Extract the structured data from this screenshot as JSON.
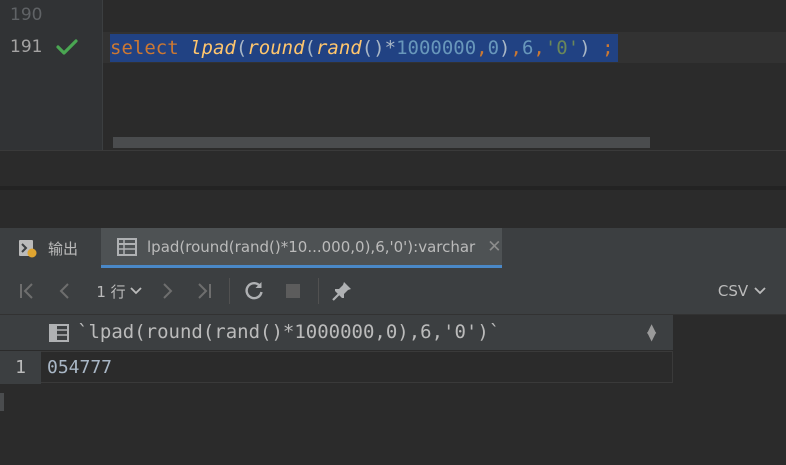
{
  "editor": {
    "lines": [
      {
        "number": "190"
      },
      {
        "number": "191"
      }
    ],
    "code_tokens": [
      {
        "text": "select",
        "cls": "kw"
      },
      {
        "text": " ",
        "cls": "pn"
      },
      {
        "text": "lpad",
        "cls": "fn"
      },
      {
        "text": "(",
        "cls": "pn"
      },
      {
        "text": "round",
        "cls": "fn"
      },
      {
        "text": "(",
        "cls": "pn"
      },
      {
        "text": "rand",
        "cls": "fn"
      },
      {
        "text": "()*",
        "cls": "pn"
      },
      {
        "text": "1000000",
        "cls": "num"
      },
      {
        "text": ",",
        "cls": "kw"
      },
      {
        "text": "0",
        "cls": "num"
      },
      {
        "text": ")",
        "cls": "pn"
      },
      {
        "text": ",",
        "cls": "kw"
      },
      {
        "text": "6",
        "cls": "num"
      },
      {
        "text": ",",
        "cls": "kw"
      },
      {
        "text": "'0'",
        "cls": "str"
      },
      {
        "text": ") ",
        "cls": "pn"
      },
      {
        "text": ";",
        "cls": "kw"
      }
    ],
    "status_icon": "checkmark-icon",
    "status_color": "#4aa652",
    "selection_color": "#214283"
  },
  "panel": {
    "tabs": [
      {
        "label": "输出",
        "icon": "output-icon"
      },
      {
        "label": "lpad(round(rand()*10...000,0),6,'0'):varchar",
        "icon": "table-icon"
      }
    ],
    "close_glyph": "✕",
    "accent": "#4a88c7"
  },
  "toolbar": {
    "rows_label": "1 行",
    "export_label": "CSV"
  },
  "grid": {
    "column_header": "`lpad(round(rand()*1000000,0),6,'0')`",
    "rows": [
      {
        "num": "1",
        "value": "054777"
      }
    ]
  }
}
